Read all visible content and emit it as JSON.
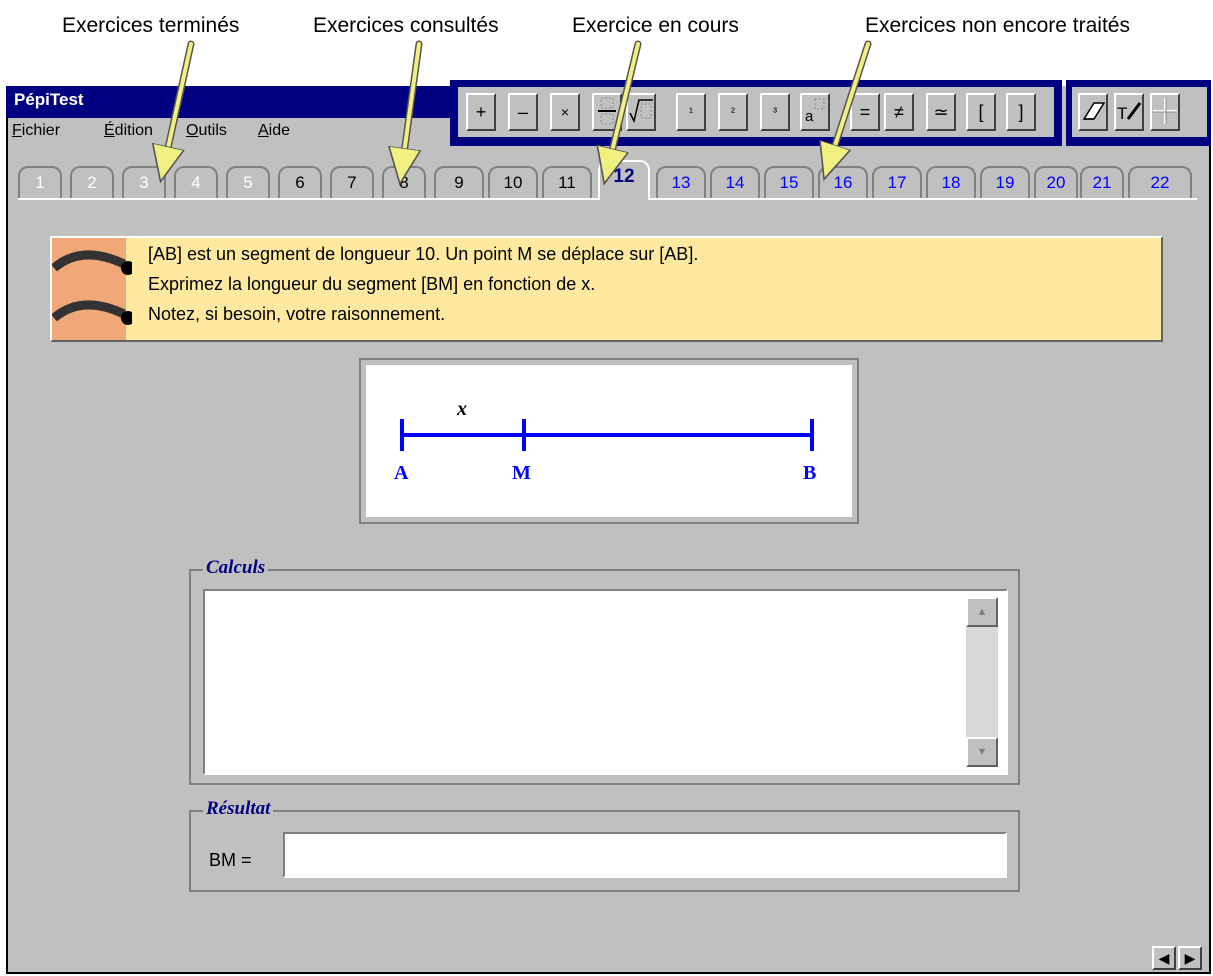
{
  "callouts": [
    "Exercices terminés",
    "Exercices consultés",
    "Exercice en cours",
    "Exercices non encore traités"
  ],
  "app": {
    "title": "PépiTest"
  },
  "menu": [
    {
      "underline": "F",
      "rest": "ichier"
    },
    {
      "underline": "É",
      "rest": "dition"
    },
    {
      "underline": "O",
      "rest": "utils"
    },
    {
      "underline": "A",
      "rest": "ide"
    }
  ],
  "math_toolbar": [
    "+",
    "–",
    "×",
    "fraction-icon",
    "sqrt-icon",
    "¹",
    "²",
    "³",
    "power-icon",
    "=",
    "≠",
    "≃",
    "[",
    "]"
  ],
  "tools": [
    "eraser-icon",
    "text-pen-icon",
    "crosshair-icon"
  ],
  "tabs": {
    "done": [
      "1",
      "2",
      "3",
      "4",
      "5"
    ],
    "seen": [
      "6",
      "7",
      "8",
      "9",
      "10",
      "11"
    ],
    "current": "12",
    "todo": [
      "13",
      "14",
      "15",
      "16",
      "17",
      "18",
      "19",
      "20",
      "21",
      "22"
    ]
  },
  "question": {
    "line1": "[AB] est un segment de longueur 10. Un point M se déplace sur [AB].",
    "line2": "Exprimez la longueur du segment [BM] en fonction de x.",
    "line3": "Notez, si besoin, votre raisonnement."
  },
  "figure": {
    "var": "x",
    "points": [
      "A",
      "M",
      "B"
    ]
  },
  "calculs": {
    "legend": "Calculs",
    "value": ""
  },
  "resultat": {
    "legend": "Résultat",
    "label": "BM =",
    "value": ""
  },
  "colors": {
    "title_bar": "#000080",
    "window": "#c0c0c0",
    "question_bg": "#ffe9a0",
    "segment": "#0000ff",
    "todo_tab": "#0000ff",
    "legend": "#000080",
    "arrow": "#f0f080"
  }
}
